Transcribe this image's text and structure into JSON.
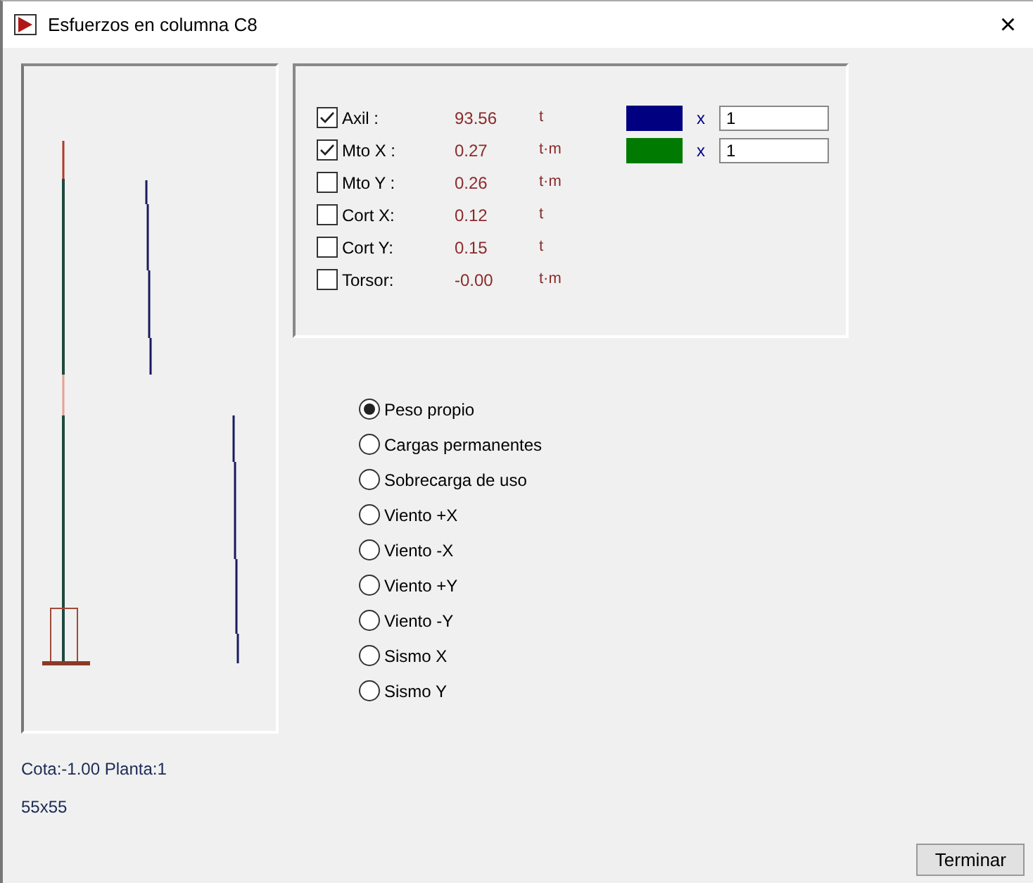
{
  "window": {
    "title": "Esfuerzos en columna C8",
    "close": "×"
  },
  "efforts": [
    {
      "label": "Axil  :",
      "checked": true,
      "value": "93.56",
      "unit": "t",
      "color": "#000080",
      "multiplier": "x",
      "factor": "1"
    },
    {
      "label": "Mto X :",
      "checked": true,
      "value": "0.27",
      "unit": "t·m",
      "color": "#007a00",
      "multiplier": "x",
      "factor": "1"
    },
    {
      "label": "Mto Y :",
      "checked": false,
      "value": "0.26",
      "unit": "t·m"
    },
    {
      "label": "Cort X:",
      "checked": false,
      "value": "0.12",
      "unit": "t"
    },
    {
      "label": "Cort Y:",
      "checked": false,
      "value": "0.15",
      "unit": "t"
    },
    {
      "label": "Torsor:",
      "checked": false,
      "value": "-0.00",
      "unit": "t·m"
    }
  ],
  "load_cases": [
    {
      "label": "Peso propio",
      "selected": true
    },
    {
      "label": "Cargas permanentes",
      "selected": false
    },
    {
      "label": "Sobrecarga de uso",
      "selected": false
    },
    {
      "label": "Viento +X",
      "selected": false
    },
    {
      "label": "Viento -X",
      "selected": false
    },
    {
      "label": "Viento +Y",
      "selected": false
    },
    {
      "label": "Viento -Y",
      "selected": false
    },
    {
      "label": "Sismo X",
      "selected": false
    },
    {
      "label": "Sismo Y",
      "selected": false
    }
  ],
  "info": [
    "Cota:-1.00 Planta:1",
    "55x55"
  ],
  "buttons": [
    "Terminar"
  ]
}
